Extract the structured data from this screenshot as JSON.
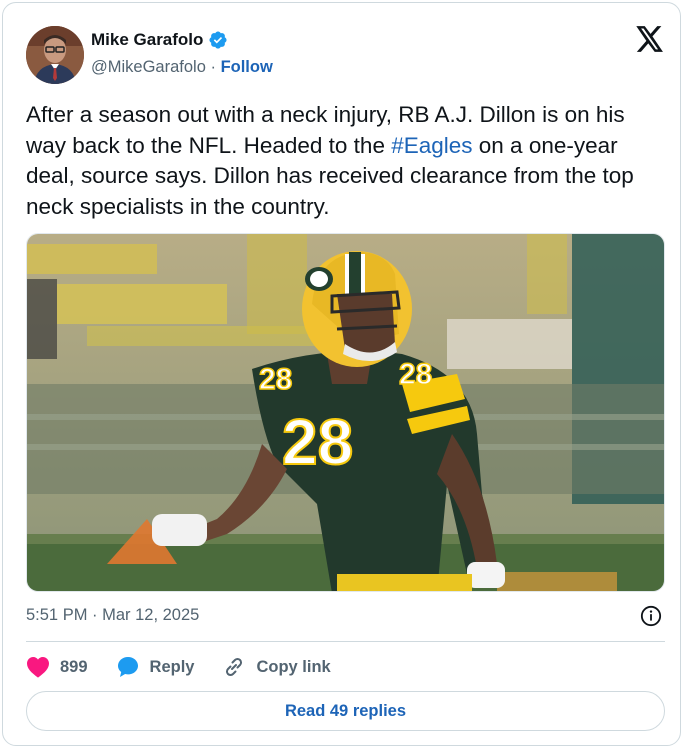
{
  "author": {
    "name": "Mike Garafolo",
    "handle": "@MikeGarafolo",
    "separator": "·",
    "follow_label": "Follow",
    "verified_icon": "verified-badge-icon"
  },
  "platform_icon": "x-logo-icon",
  "tweet": {
    "text_before": "After a season out with a neck injury, RB A.J. Dillon is on his way back to the NFL. Headed to the ",
    "hashtag": "#Eagles",
    "text_after": " on a one-year deal, source says. Dillon has received clearance from the top neck specialists in the country."
  },
  "media": {
    "jersey_number": "28"
  },
  "timestamp": "5:51 PM · Mar 12, 2025",
  "info_icon": "info-icon",
  "actions": {
    "likes": "899",
    "reply_label": "Reply",
    "copy_link_label": "Copy link"
  },
  "read_replies_label": "Read 49 replies",
  "colors": {
    "link": "#1d64b7",
    "like": "#f91880",
    "reply": "#1d9bf0",
    "verified": "#1d9bf0"
  }
}
